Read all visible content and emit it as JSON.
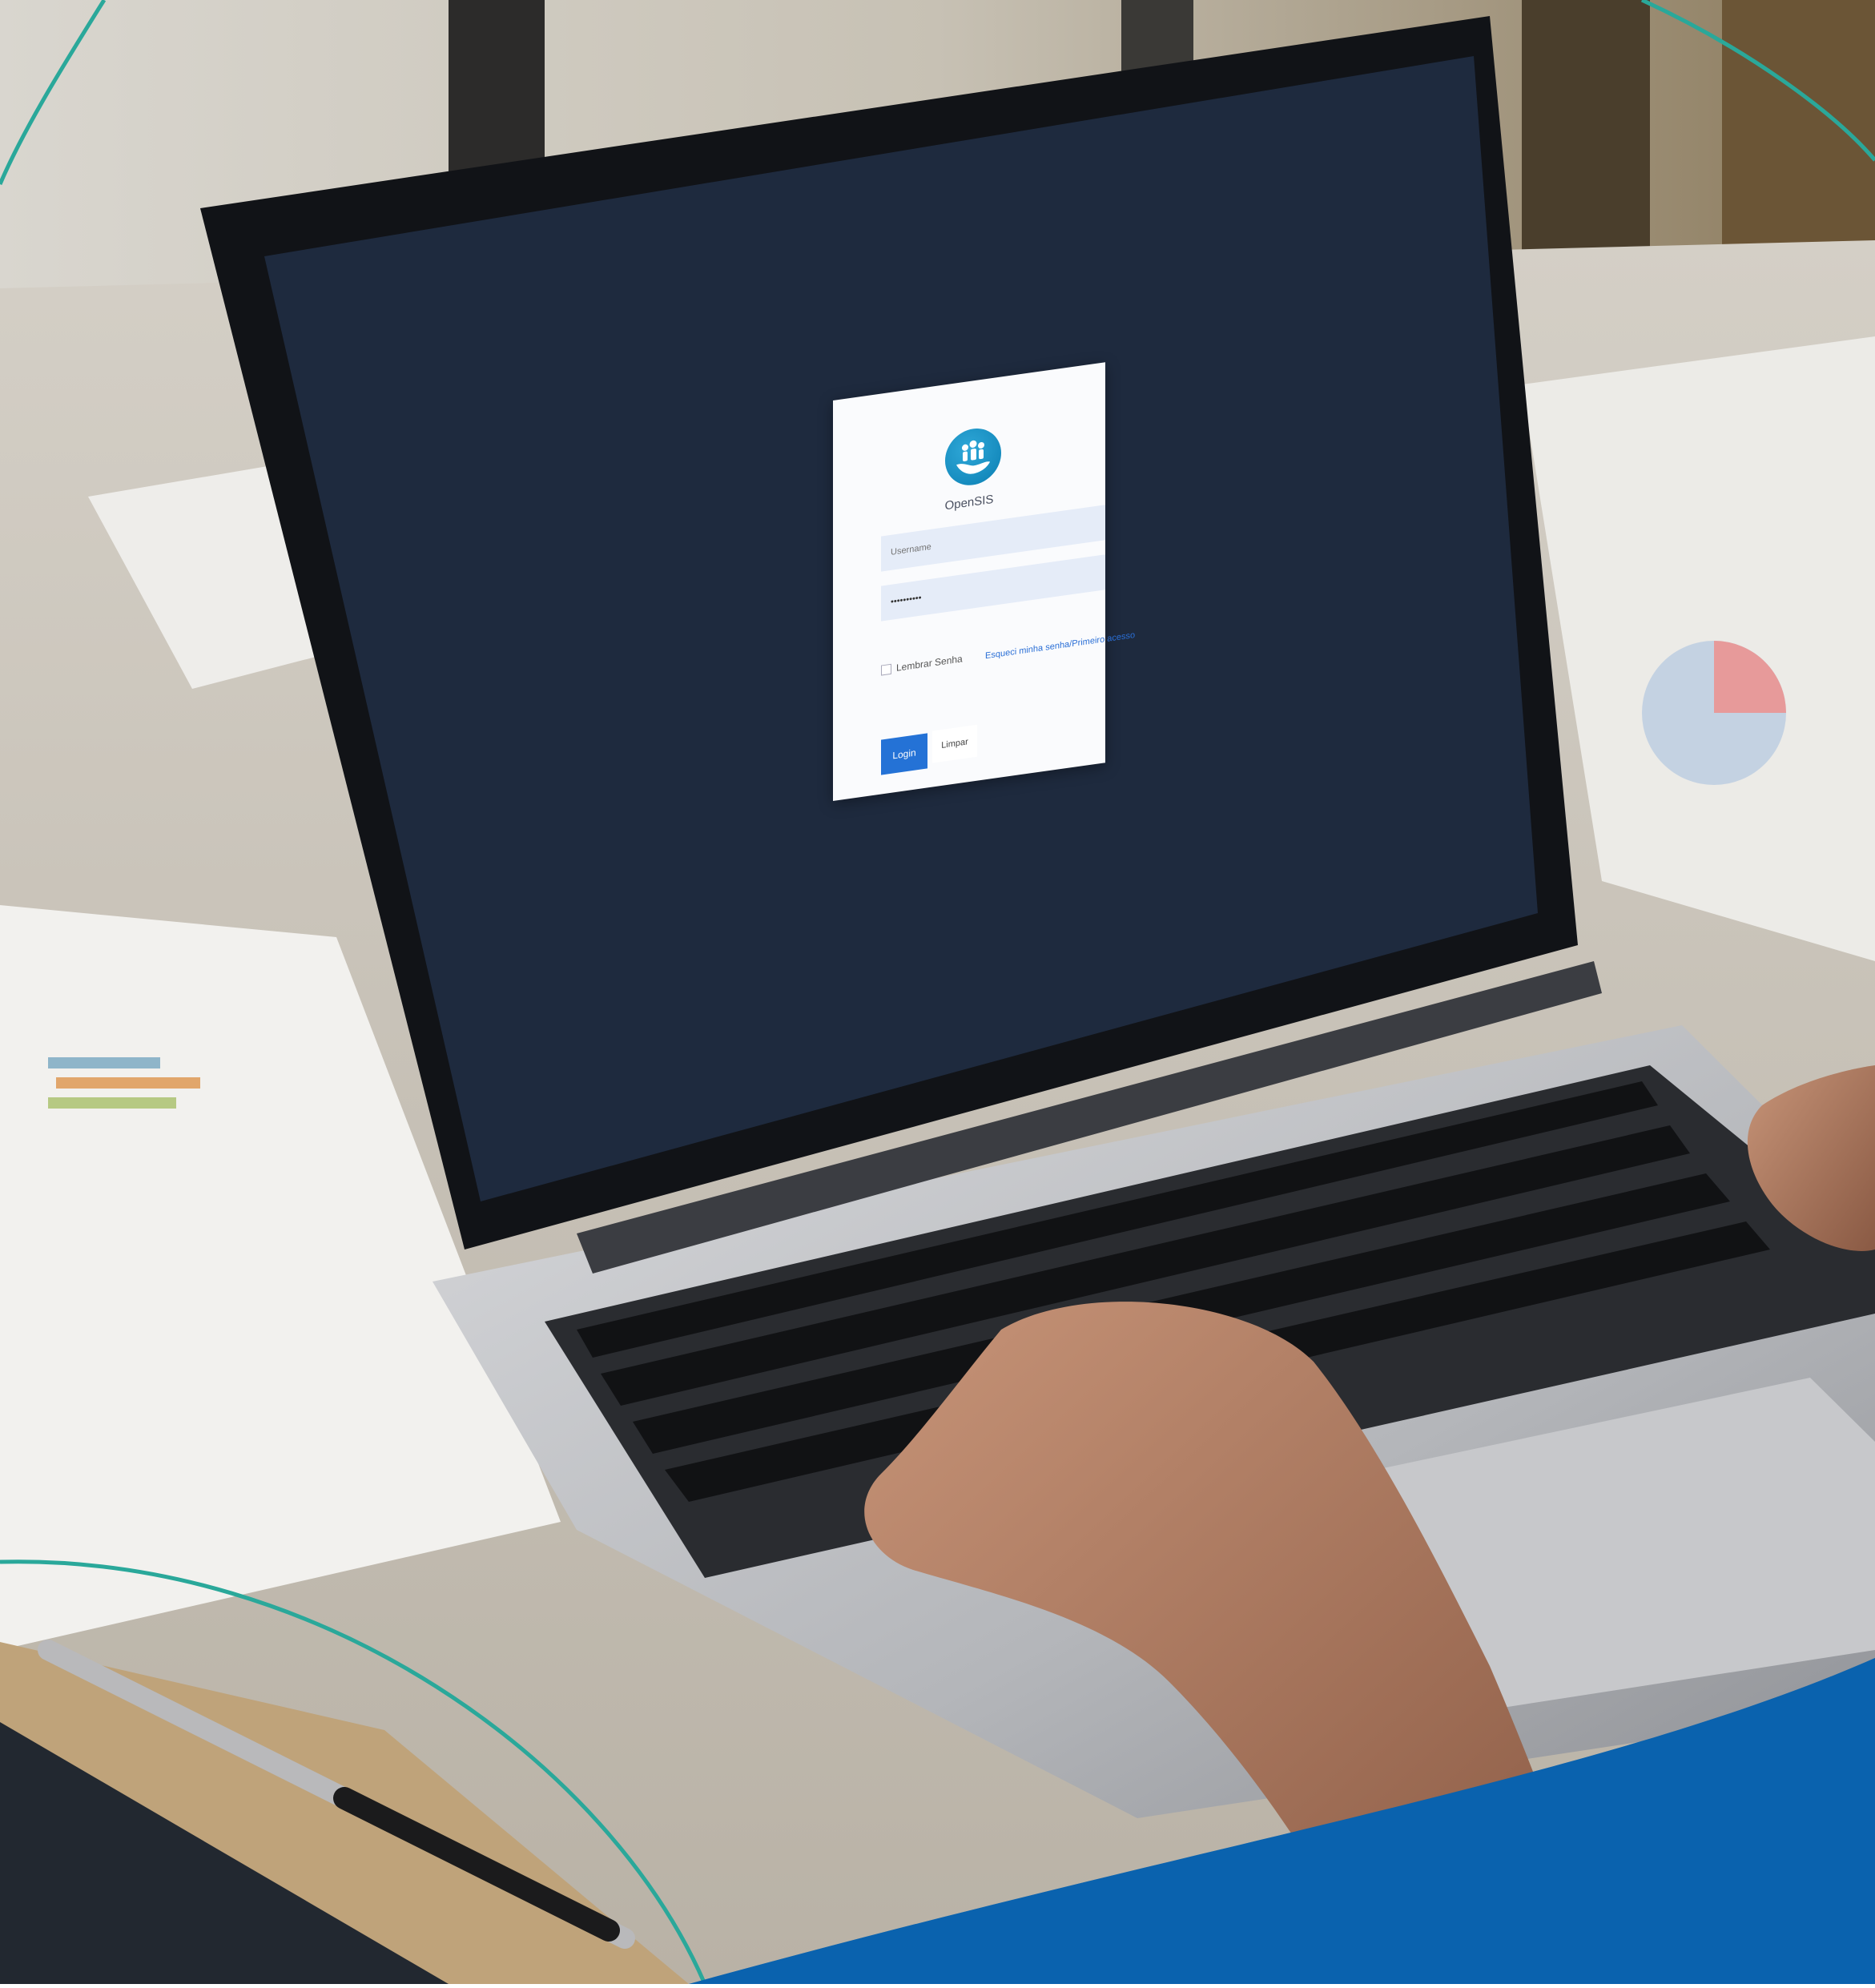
{
  "login": {
    "brand_name": "OpenSIS",
    "username_placeholder": "Username",
    "password_value": "••••••••••",
    "remember_label": "Lembrar Senha",
    "forgot_label": "Esqueci minha senha/Primeiro acesso",
    "login_label": "Login",
    "cancel_label": "Limpar"
  },
  "colors": {
    "screen": "#1e2a3e",
    "accent": "#2472d6",
    "logo": "#1693c9",
    "teal_arc": "#2aa89a",
    "blue_band": "#0a62ae"
  }
}
